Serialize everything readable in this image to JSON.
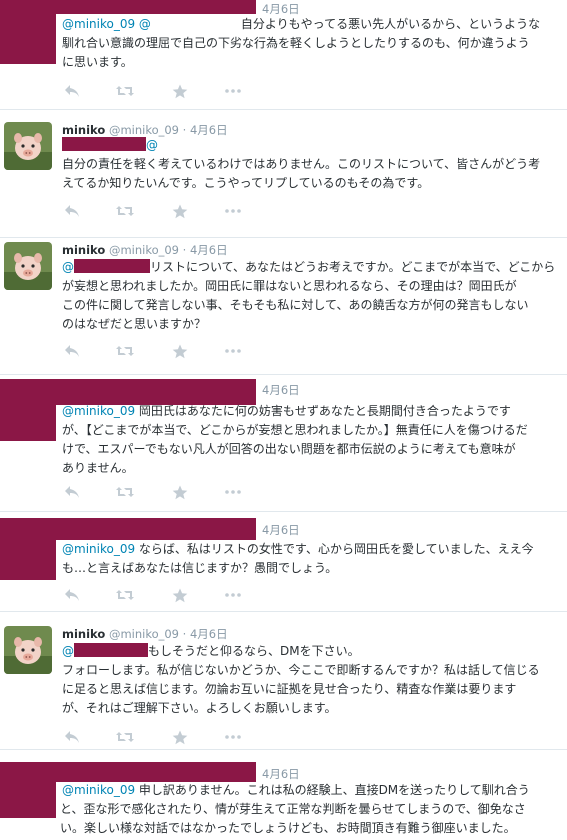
{
  "tweets": [
    {
      "author": "",
      "handle": "",
      "date": "4月6日",
      "mention_prefix": "@miniko_09 @",
      "lines": [
        "自分よりもやってる悪い先人がいるから、というような",
        "馴れ合い意識の理屈で自己の下劣な行為を軽くしようとしたりするのも、何か違うよう",
        "に思います。"
      ]
    },
    {
      "author": "miniko",
      "handle": "@miniko_09",
      "date": "4月6日",
      "mention_prefix": "@",
      "lines": [
        "自分の責任を軽く考えているわけではありません。このリストについて、皆さんがどう考",
        "えてるか知りたいんです。こうやってリプしているのもその為です。"
      ]
    },
    {
      "author": "miniko",
      "handle": "@miniko_09",
      "date": "4月6日",
      "mention_prefix": "@",
      "lines": [
        "リストについて、あなたはどうお考えですか。どこまでが本当で、どこから",
        "が妄想と思われましたか。岡田氏に罪はないと思われるなら、その理由は？岡田氏が",
        "この件に関して発言しない事、そもそも私に対して、あの饒舌な方が何の発言もしない",
        "のはなぜだと思いますか？"
      ]
    },
    {
      "author": "",
      "handle": "",
      "date": "4月6日",
      "mention_prefix": "@miniko_09",
      "lines": [
        " 岡田氏はあなたに何の妨害もせずあなたと長期間付き合ったようです",
        "が、【どこまでが本当で、どこからが妄想と思われましたか。】無責任に人を傷つけるだ",
        "けで、エスパーでもない凡人が回答の出ない問題を都市伝説のように考えても意味が",
        "ありません。"
      ]
    },
    {
      "author": "",
      "handle": "",
      "date": "4月6日",
      "mention_prefix": "@miniko_09",
      "lines": [
        " ならば、私はリストの女性です、心から岡田氏を愛していました、ええ今",
        "も…と言えばあなたは信じますか？愚問でしょう。"
      ]
    },
    {
      "author": "miniko",
      "handle": "@miniko_09",
      "date": "4月6日",
      "mention_prefix": "@",
      "lines": [
        "もしそうだと仰るなら、DMを下さい。",
        "フォローします。私が信じないかどうか、今ここで即断するんですか？私は話して信じる",
        "に足ると思えば信じます。勿論お互いに証拠を見せ合ったり、精査な作業は要ります",
        "が、それはご理解下さい。よろしくお願いします。"
      ]
    },
    {
      "author": "",
      "handle": "",
      "date": "4月6日",
      "mention_prefix": "@miniko_09",
      "lines": [
        " 申し訳ありません。これは私の経験上、直接DMを送ったりして馴れ合う",
        "と、歪な形で感化されたり、情が芽生えて正常な判断を曇らせてしまうので、御免なさ",
        "い。楽しい様な対話ではなかったでしょうけども、お時間頂き有難う御座いました。"
      ]
    }
  ],
  "icons": {
    "reply": "reply-icon",
    "retweet": "retweet-icon",
    "favorite": "star-icon",
    "more": "more-icon"
  },
  "colors": {
    "redaction": "#8b1746",
    "mention": "#0084b4",
    "meta": "#8899a6",
    "action": "#c3ccd3"
  }
}
